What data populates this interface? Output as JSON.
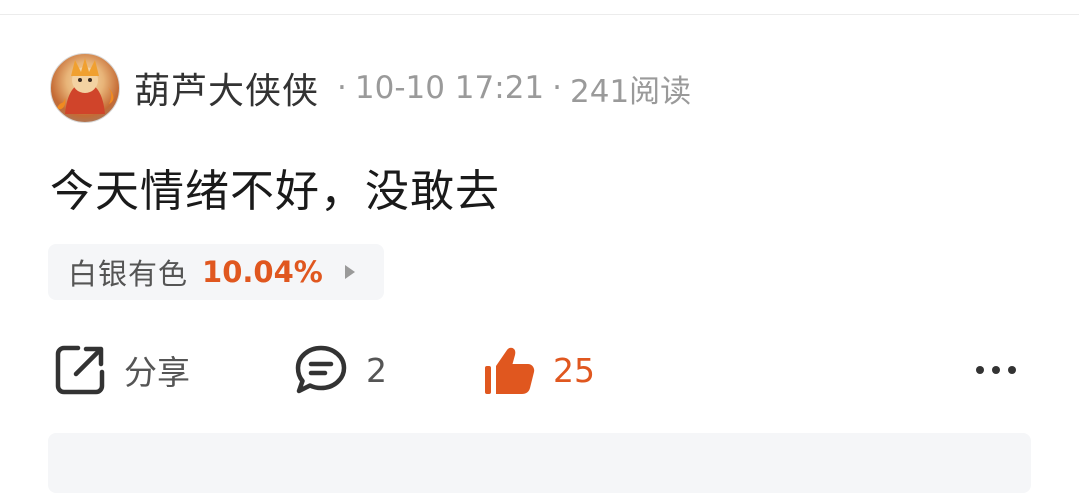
{
  "post": {
    "author": "葫芦大侠侠",
    "separator": "·",
    "timestamp": "10-10 17:21",
    "reads": "241阅读",
    "content": "今天情绪不好，没敢去"
  },
  "stock_tag": {
    "name": "白银有色",
    "change": "10.04%"
  },
  "actions": {
    "share_label": "分享",
    "comment_count": "2",
    "like_count": "25"
  },
  "colors": {
    "accent": "#e0571f",
    "meta_gray": "#9a9a9a",
    "tag_bg": "#f5f6f8"
  },
  "icons": [
    "share-icon",
    "comment-icon",
    "thumbs-up-icon",
    "more-icon",
    "chevron-right-icon"
  ]
}
